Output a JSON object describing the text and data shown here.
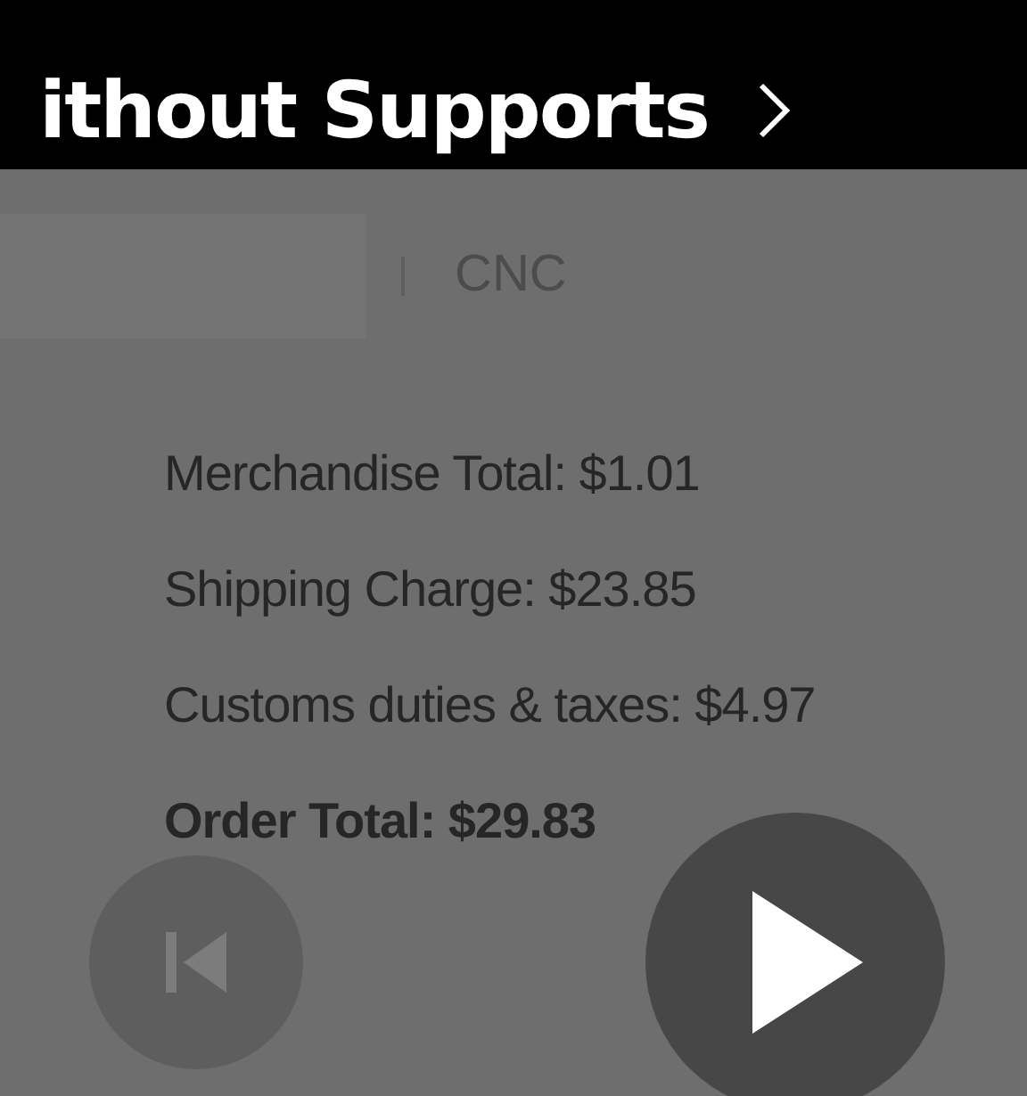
{
  "title": "ithout Supports",
  "tab_label": "CNC",
  "summary": [
    {
      "text": "Merchandise Total: $1.01",
      "bold": false
    },
    {
      "text": "Shipping Charge: $23.85",
      "bold": false
    },
    {
      "text": "Customs duties & taxes: $4.97",
      "bold": false
    },
    {
      "text": "Order Total: $29.83",
      "bold": true
    }
  ]
}
